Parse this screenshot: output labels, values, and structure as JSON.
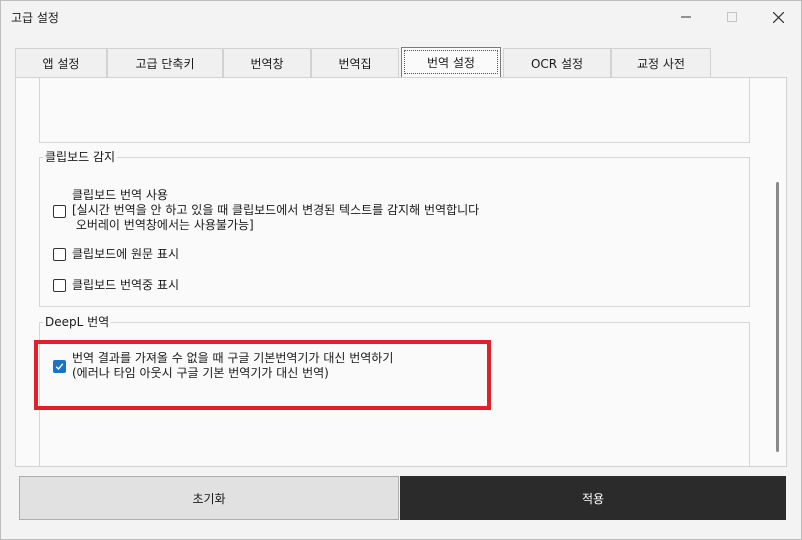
{
  "window": {
    "title": "고급 설정",
    "minimize_icon": "minimize-icon",
    "maximize_icon": "maximize-icon",
    "close_icon": "close-icon"
  },
  "tabs": [
    {
      "label": "앱 설정"
    },
    {
      "label": "고급 단축키"
    },
    {
      "label": "번역창"
    },
    {
      "label": "번역집"
    },
    {
      "label": "번역 설정",
      "active": true
    },
    {
      "label": "OCR 설정"
    },
    {
      "label": "교정 사전"
    }
  ],
  "clipboard_group": {
    "title": "클립보드 감지",
    "use_translation": {
      "label": "클립보드 번역 사용\n[실시간 번역을 안 하고 있을 때 클립보드에서 변경된 텍스트를 감지해 번역합니다\n 오버레이 번역창에서는 사용불가능]",
      "checked": false
    },
    "show_original": {
      "label": "클립보드에 원문 표시",
      "checked": false
    },
    "show_translating": {
      "label": "클립보드 번역중 표시",
      "checked": false
    }
  },
  "deepl_group": {
    "title": "DeepL 번역",
    "fallback": {
      "label": "번역 결과를 가져올 수 없을 때 구글 기본번역기가 대신 번역하기\n(에러나 타임 아웃시 구글 기본 번역기가 대신 번역)",
      "checked": true
    }
  },
  "buttons": {
    "reset_label": "초기화",
    "apply_label": "적용"
  },
  "colors": {
    "accent": "#1a73c9",
    "highlight": "#e0202a",
    "apply_bg": "#2b2b2b"
  }
}
